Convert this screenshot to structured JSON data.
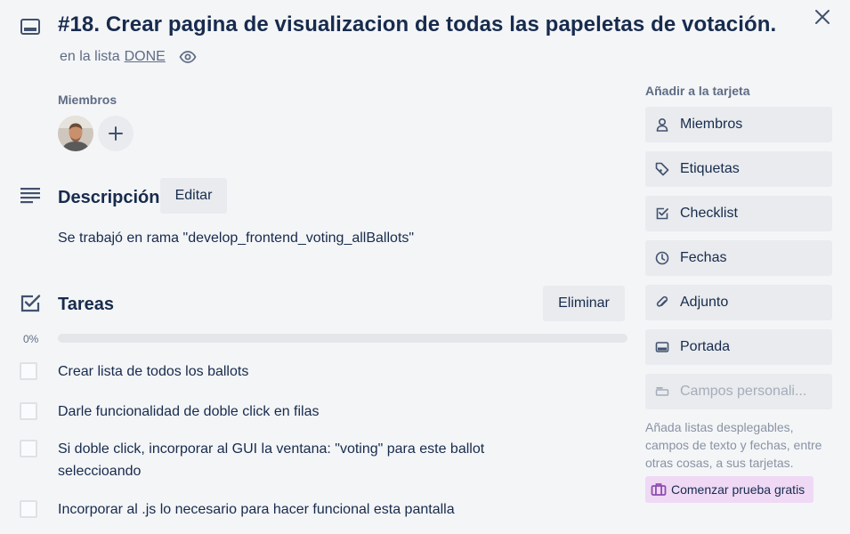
{
  "card": {
    "title": "#18. Crear pagina de visualizacion de todas las papeletas de votación.",
    "list_prefix": "en la lista",
    "list_name": "DONE"
  },
  "members": {
    "title": "Miembros"
  },
  "description": {
    "title": "Descripción",
    "edit_label": "Editar",
    "text": "Se trabajó en rama \"develop_frontend_voting_allBallots\""
  },
  "checklist": {
    "title": "Tareas",
    "delete_label": "Eliminar",
    "progress_label": "0%",
    "progress_value": 0,
    "items": [
      {
        "text": "Crear lista de todos los ballots",
        "checked": false
      },
      {
        "text": "Darle funcionalidad de doble click en filas",
        "checked": false
      },
      {
        "text": "Si doble click, incorporar al GUI la ventana: \"voting\" para este ballot seleccioando",
        "checked": false
      },
      {
        "text": "Incorporar al .js lo necesario para hacer funcional esta pantalla",
        "checked": false
      }
    ]
  },
  "sidebar": {
    "title": "Añadir a la tarjeta",
    "buttons": [
      {
        "label": "Miembros",
        "icon": "person-icon"
      },
      {
        "label": "Etiquetas",
        "icon": "tag-icon"
      },
      {
        "label": "Checklist",
        "icon": "checklist-icon"
      },
      {
        "label": "Fechas",
        "icon": "clock-icon"
      },
      {
        "label": "Adjunto",
        "icon": "paperclip-icon"
      },
      {
        "label": "Portada",
        "icon": "cover-icon"
      },
      {
        "label": "Campos personali...",
        "icon": "custom-fields-icon"
      }
    ],
    "help_text": "Añada listas desplegables, campos de texto y fechas, entre otras cosas, a sus tarjetas.",
    "trial_label": "Comenzar prueba gratis"
  },
  "colors": {
    "progress_fill": "#5ba4cf",
    "trial_bg": "#efd9f5",
    "trial_icon": "#8f4db0"
  }
}
